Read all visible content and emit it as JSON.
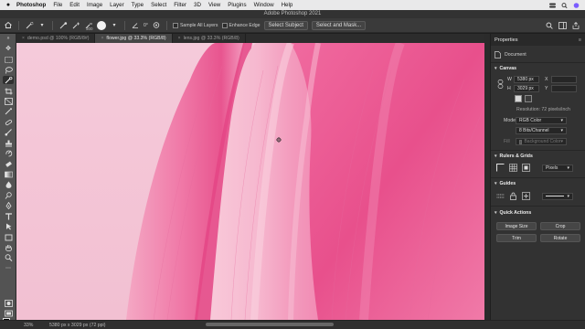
{
  "menubar": {
    "app": "Photoshop",
    "items": [
      "File",
      "Edit",
      "Image",
      "Layer",
      "Type",
      "Select",
      "Filter",
      "3D",
      "View",
      "Plugins",
      "Window",
      "Help"
    ]
  },
  "window": {
    "title": "Adobe Photoshop 2021"
  },
  "options": {
    "brush_size": "300",
    "angle": "0°",
    "sample_all_layers": "Sample All Layers",
    "enhance_edge": "Enhance Edge",
    "select_subject": "Select Subject",
    "select_and_mask": "Select and Mask..."
  },
  "tabs": [
    {
      "label": "demo.psd @ 100% (RGB/8#)"
    },
    {
      "label": "flower.jpg @ 33.3% (RGB/8)"
    },
    {
      "label": "lens.jpg @ 33.3% (RGB/8)"
    }
  ],
  "status": {
    "zoom": "33%",
    "doc_info": "5380 px x 3029 px (72 ppi)"
  },
  "panel": {
    "tab": "Properties",
    "document_label": "Document",
    "canvas": {
      "title": "Canvas",
      "w_label": "W",
      "w_value": "5380 px",
      "x_label": "X",
      "h_label": "H",
      "h_value": "3029 px",
      "y_label": "Y",
      "resolution": "Resolution: 72 pixels/inch",
      "mode_label": "Mode",
      "mode_value": "RGB Color",
      "bits_value": "8 Bits/Channel",
      "fill_label": "Fill",
      "fill_value": "Background Color"
    },
    "rulers": {
      "title": "Rulers & Grids",
      "units": "Pixels"
    },
    "guides": {
      "title": "Guides"
    },
    "quick_actions": {
      "title": "Quick Actions",
      "buttons": [
        "Image Size",
        "Crop",
        "Trim",
        "Rotate"
      ]
    }
  }
}
